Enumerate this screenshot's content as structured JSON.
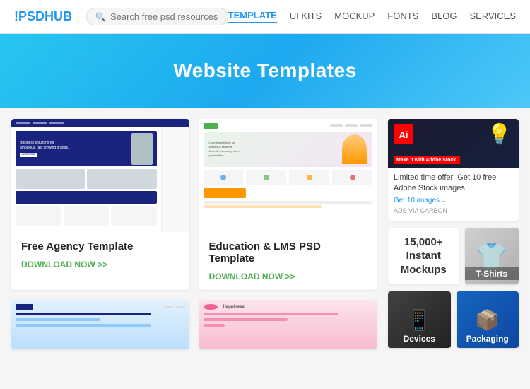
{
  "header": {
    "logo_prefix": "!PSD",
    "logo_suffix": "HUB",
    "search_placeholder": "Search free psd resources",
    "nav_items": [
      {
        "label": "TEMPLATE",
        "active": true
      },
      {
        "label": "UI KITS",
        "active": false
      },
      {
        "label": "MOCKUP",
        "active": false
      },
      {
        "label": "FONTS",
        "active": false
      },
      {
        "label": "BLOG",
        "active": false
      },
      {
        "label": "SERVICES",
        "active": false
      }
    ]
  },
  "hero": {
    "title": "Website Templates"
  },
  "cards": [
    {
      "title": "Free Agency Template",
      "download_label": "DOWNLOAD NOW >>"
    },
    {
      "title": "Education & LMS PSD Template",
      "download_label": "DOWNLOAD NOW >>"
    }
  ],
  "sidebar": {
    "ad": {
      "text": "Limited time offer: Get 10 free Adobe Stock images.",
      "link": "Get 10 images→",
      "via": "ADS VIA CARBON"
    },
    "mockup_wide": {
      "text": "15,000+\nInstant\nMockups"
    },
    "mockup_tshirt": {
      "label": "T-Shirts"
    },
    "mockup_devices": {
      "label": "Devices"
    },
    "mockup_packaging": {
      "label": "Packaging"
    }
  }
}
